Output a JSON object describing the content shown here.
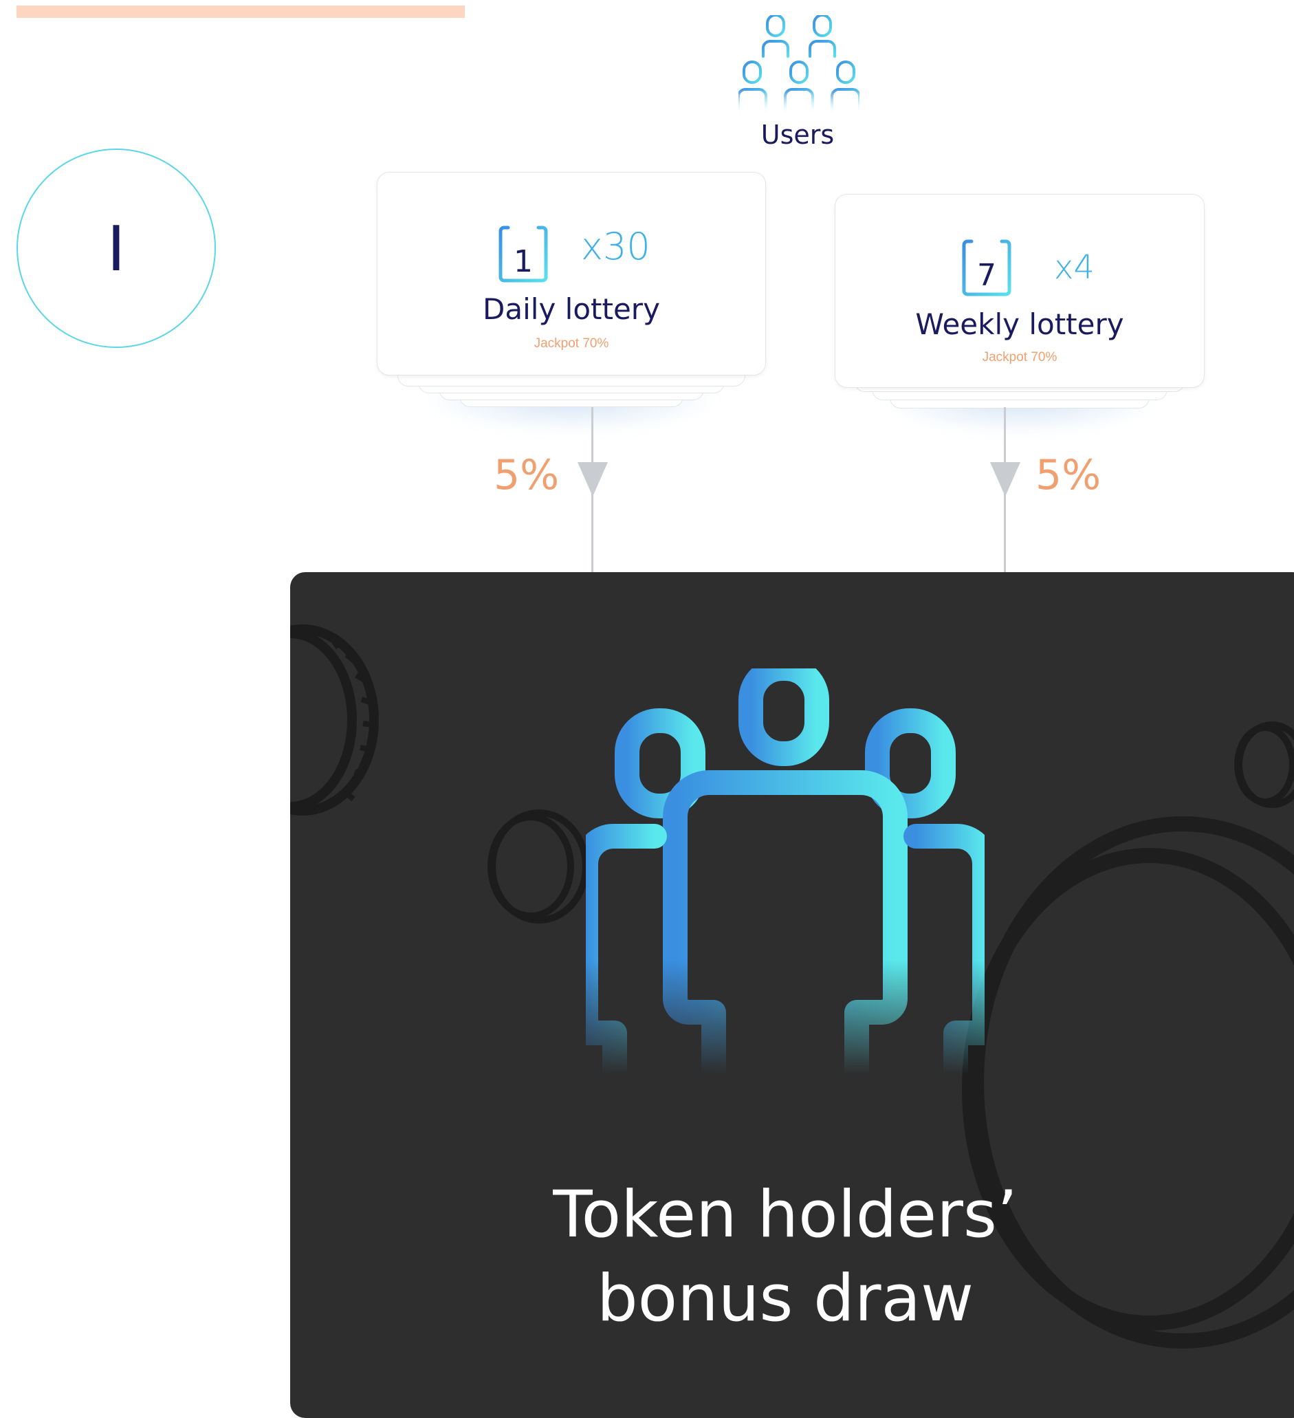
{
  "diagram": {
    "users_label": "Users",
    "cards": [
      {
        "id": "daily",
        "title": "Daily lottery",
        "day_number": "1",
        "multiplier": "x30",
        "jackpot": "Jackpot 70%",
        "percentage": "5%"
      },
      {
        "id": "weekly",
        "title": "Weekly lottery",
        "day_number": "7",
        "multiplier": "x4",
        "jackpot": "Jackpot 70%",
        "percentage": "5%"
      }
    ],
    "section_number": "I",
    "panel_title_line1": "Token holders’",
    "panel_title_line2": "bonus draw"
  },
  "colors": {
    "accent_blue": "#3fb0e8",
    "accent_cyan": "#5ae8ec",
    "navy_text": "#1a1a5e",
    "orange_text": "#f0a070",
    "top_bar": "#fcd6c0",
    "panel_background": "#2e2e2e",
    "connector_gray": "#c9ccd0"
  },
  "icons": [
    "users-group-icon",
    "calendar-day-icon",
    "calendar-week-icon",
    "token-holders-icon",
    "coin-icon"
  ]
}
